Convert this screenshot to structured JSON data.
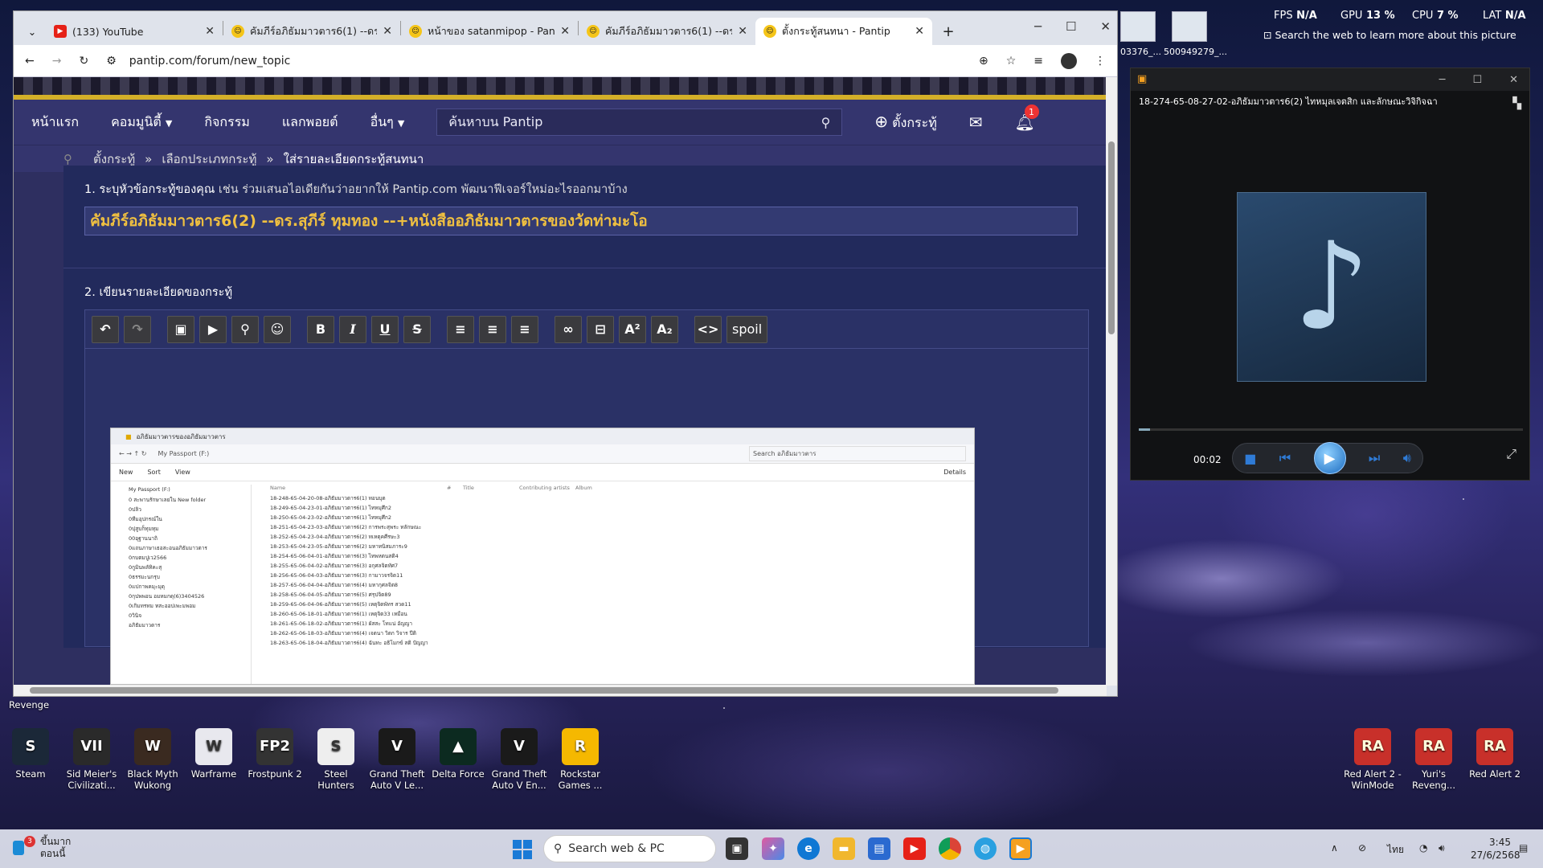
{
  "widgets": {
    "fps_label": "FPS",
    "fps": "N/A",
    "gpu_label": "GPU",
    "gpu": "13 %",
    "cpu_label": "CPU",
    "cpu": "7 %",
    "lat_label": "LAT",
    "lat": "N/A",
    "search_hint": "Search the web to learn more about this picture",
    "thumb1": "03376_...",
    "thumb2": "500949279_..."
  },
  "desktop_left": [
    {
      "label": "Steam"
    },
    {
      "label": "Sid Meier's Civilizati..."
    },
    {
      "label": "Black Myth Wukong"
    },
    {
      "label": "Warframe"
    },
    {
      "label": "Frostpunk 2"
    },
    {
      "label": "Steel Hunters"
    },
    {
      "label": "Grand Theft Auto V Le..."
    },
    {
      "label": "Delta Force"
    },
    {
      "label": "Grand Theft Auto V En..."
    },
    {
      "label": "Rockstar Games ..."
    }
  ],
  "desktop_right": [
    {
      "label": "Red Alert 2 - WinMode"
    },
    {
      "label": "Yuri's Reveng..."
    },
    {
      "label": "Red Alert 2"
    }
  ],
  "desktop_partial": {
    "revenge": "Revenge"
  },
  "browser": {
    "tabs": [
      {
        "title": "(133) YouTube"
      },
      {
        "title": "คัมภีร์อภิธัมมาวตาร6(1) --ดร.สุภ"
      },
      {
        "title": "หน้าของ satanmipop - Pantip"
      },
      {
        "title": "คัมภีร์อภิธัมมาวตาร6(1) --ดร.สุภ"
      },
      {
        "title": "ตั้งกระทู้สนทนา - Pantip"
      }
    ],
    "new_tab": "+",
    "url": "pantip.com/forum/new_topic"
  },
  "pantip": {
    "nav": {
      "home": "หน้าแรก",
      "community": "คอมมูนิตี้",
      "activities": "กิจกรรม",
      "points": "แลกพอยต์",
      "more": "อื่นๆ",
      "search_placeholder": "ค้นหาบน Pantip",
      "new_topic": "ตั้งกระทู้",
      "notif_count": "1"
    },
    "breadcrumb": [
      "ตั้งกระทู้",
      "เลือกประเภทกระทู้",
      "ใส่รายละเอียดกระทู้สนทนา"
    ],
    "sep": "»",
    "step1_label": "1. ระบุหัวข้อกระทู้ของคุณ",
    "step1_hint": " เช่น ร่วมเสนอไอเดียกันว่าอยากให้ Pantip.com พัฒนาฟีเจอร์ใหม่อะไรออกมาบ้าง",
    "title_value": "คัมภีร์อภิธัมมาวตาร6(2) --ดร.สุภีร์ ทุมทอง --+หนังสืออภิธัมมาวตารของวัดท่ามะโอ",
    "step2_label": "2. เขียนรายละเอียดของกระทู้",
    "toolbar": {
      "undo": "↶",
      "redo": "↷",
      "image": "▣",
      "youtube": "▶",
      "map": "⚲",
      "emoji": "☺",
      "bold": "B",
      "italic": "I",
      "underline": "U",
      "strike": "S",
      "left": "≡",
      "center": "≡",
      "right": "≡",
      "link": "∞",
      "hr": "⊟",
      "sup": "A²",
      "sub": "A₂",
      "code": "<>",
      "spoil": "spoil"
    }
  },
  "explorer": {
    "tab": "อภิธัมมาวตารของอภิธัมมาวตาร",
    "path": "My Passport (F:)",
    "search": "Search อภิธัมมาวตาร",
    "new": "New",
    "sort": "Sort",
    "view": "View",
    "details": "Details",
    "cols": [
      "Name",
      "#",
      "Title",
      "Contributing artists",
      "Album"
    ],
    "side": [
      "My Passport (F:)",
      "0 สะพานรักษาเลยใน New folder",
      "0ปลิว",
      "0ทีมอุปกรณ์ใน",
      "0ปุสูบก็ทุมทุม",
      "00อุฐานนาถิ",
      "0แถนภาษาเธอสะอนอภิธัมมาวตาร",
      "0กบตมปูเว2566",
      "0กูมินพลัทิคะสุ",
      "0ธรรมะนกรุบ",
      "0แปกาพคมุะมุดุ",
      "0กุปพพอน อมหมกดุ(6)3404526",
      "0เกิมทรทม ทสะออปเพะมพอม",
      "0วินิจ",
      "อภิธัมมาวตาร"
    ],
    "files": [
      "18-248-65-04-20-08-อภิธัมมาวตาร6(1) ทอนบุต",
      "18-249-65-04-23-01-อภิธัมมาวตาร6(1) ไทหมุศึก2",
      "18-250-65-04-23-02-อภิธัมมาวตาร6(1) ไทหมุศึก2",
      "18-251-65-04-23-03-อภิธัมมาวตาร6(2) การพระสุพระ ทลักษณะ",
      "18-252-65-04-23-04-อภิธัมมาวตาร6(2) ทเหตุคศีรษะ3",
      "18-253-65-04-23-05-อภิธัมมาวตาร6(2) มหาทนิสมภาระ9",
      "18-254-65-06-04-01-อภิธัมมาวตาร6(3) ไทพหตนสติ4",
      "18-255-65-06-04-02-อภิธัมมาวตาร6(3) อกุศลจิตทัศ7",
      "18-256-65-06-04-03-อภิธัมมาวตาร6(3) กามาวจรจิต11",
      "18-257-65-06-04-04-อภิธัมมาวตาร6(4) มหากุศลจิต8",
      "18-258-65-06-04-05-อภิธัมมาวตาร6(5) ศรุปจิต89",
      "18-259-65-06-04-06-อภิธัมมาวตาร6(5) เหตุจิตพัทร สวด11",
      "18-260-65-06-18-01-อภิธัมมาวตาร6(1) เหตุจิต33 เหมือน",
      "18-261-65-06-18-02-อภิธัมมาวตาร6(1) ผัสสะ โทแน่ อัญญา",
      "18-262-65-06-18-03-อภิธัมมาวตาร6(4) เจตนา วิตก วิจาร ปีติ",
      "18-263-65-06-18-04-อภิธัมมาวตาร6(4) ฉันทะ อธิโมกข์ สติ ปัญญา"
    ]
  },
  "player": {
    "file": "18-274-65-08-27-02-อภิธัมมาวตาร6(2) ไทหมุลเจตสิก และลักษณะวิจิกิจฉา",
    "time": "00:02",
    "progress": 0.03
  },
  "taskbar": {
    "weather": "ขึ้นมาก",
    "weather2": "ตอนนี้",
    "weather_badge": "3",
    "search": "Search web & PC",
    "lang": "ไทย",
    "time": "3:45",
    "date": "27/6/2568"
  }
}
